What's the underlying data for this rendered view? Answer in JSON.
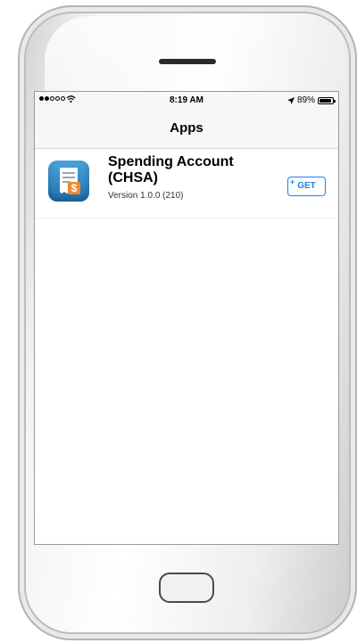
{
  "status_bar": {
    "time": "8:19 AM",
    "battery": "89%",
    "battery_level": 0.89,
    "signal_bars_filled": 2,
    "signal_bars_total": 5
  },
  "nav": {
    "title": "Apps"
  },
  "apps": [
    {
      "name": "Spending Account (CHSA)",
      "version": "Version 1.0.0 (210)",
      "action_label": "GET",
      "icon": "receipt-dollar-icon"
    }
  ],
  "colors": {
    "accent": "#1a84e8",
    "icon_blue": "#2a85c9",
    "dollar_orange": "#f08a2a"
  }
}
